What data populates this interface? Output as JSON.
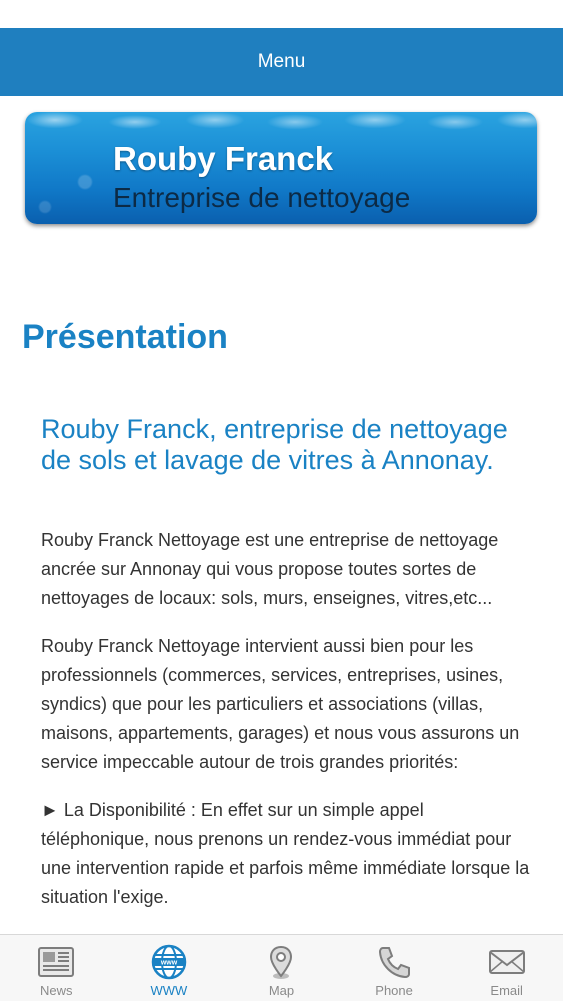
{
  "header": {
    "menu_label": "Menu"
  },
  "banner": {
    "title": "Rouby Franck",
    "subtitle": "Entreprise de nettoyage"
  },
  "page": {
    "title": "Présentation",
    "heading": "Rouby Franck, entreprise de nettoyage de sols  et lavage de vitres à Annonay.",
    "paragraphs": [
      "Rouby Franck Nettoyage est une entreprise de nettoyage ancrée sur Annonay qui vous propose toutes sortes de nettoyages de locaux: sols, murs, enseignes, vitres,etc...",
      "Rouby Franck Nettoyage intervient aussi bien pour les professionnels (commerces, services, entreprises, usines, syndics) que pour les particuliers et associations (villas, maisons, appartements, garages) et nous vous assurons un service impeccable autour de trois grandes priorités:",
      "► La Disponibilité : En effet sur un simple appel téléphonique, nous prenons un rendez-vous immédiat pour une intervention rapide et parfois même immédiate lorsque la situation l'exige."
    ]
  },
  "tabs": [
    {
      "label": "News",
      "icon": "newspaper-icon",
      "active": false
    },
    {
      "label": "WWW",
      "icon": "globe-icon",
      "active": true
    },
    {
      "label": "Map",
      "icon": "map-pin-icon",
      "active": false
    },
    {
      "label": "Phone",
      "icon": "phone-icon",
      "active": false
    },
    {
      "label": "Email",
      "icon": "envelope-icon",
      "active": false
    }
  ],
  "colors": {
    "accent": "#1a82c4",
    "header_bg": "#1f7fbf"
  }
}
